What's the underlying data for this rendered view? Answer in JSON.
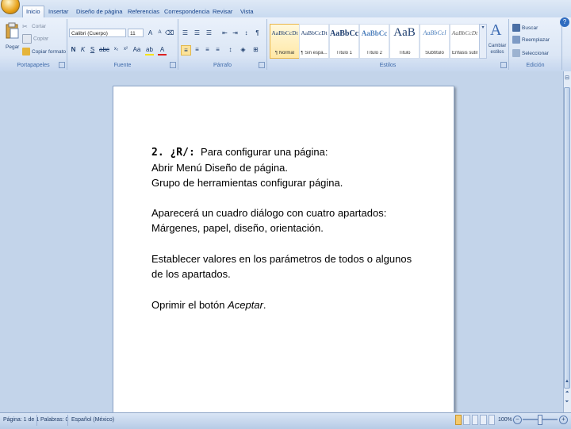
{
  "tabs": [
    "Inicio",
    "Insertar",
    "Diseño de página",
    "Referencias",
    "Correspondencia",
    "Revisar",
    "Vista"
  ],
  "clipboard": {
    "paste": "Pegar",
    "cut": "Cortar",
    "copy": "Copiar",
    "format_painter": "Copiar formato",
    "label": "Portapapeles"
  },
  "font": {
    "name": "Calibri (Cuerpo)",
    "size": "11",
    "label": "Fuente"
  },
  "paragraph": {
    "label": "Párrafo"
  },
  "styles": {
    "label": "Estilos",
    "items": [
      {
        "preview": "AaBbCcDt",
        "name": "¶ Normal"
      },
      {
        "preview": "AaBbCcDt",
        "name": "¶ Sin espa..."
      },
      {
        "preview": "AaBbCc",
        "name": "Título 1"
      },
      {
        "preview": "AaBbCc",
        "name": "Título 2"
      },
      {
        "preview": "AaB",
        "name": "Título"
      },
      {
        "preview": "AaBbCcl",
        "name": "Subtítulo"
      },
      {
        "preview": "AaBbCcDt",
        "name": "Énfasis sutil"
      }
    ],
    "change_styles": "Cambiar estilos"
  },
  "editing": {
    "find": "Buscar",
    "replace": "Reemplazar",
    "select": "Seleccionar",
    "label": "Edición"
  },
  "document": {
    "q_tag": "2. ¿R/:",
    "line1": "Para configurar una página:",
    "line2": "Abrir Menú Diseño de página.",
    "line3": "Grupo de herramientas configurar página.",
    "para2": "Aparecerá un cuadro diálogo con cuatro apartados: Márgenes, papel, diseño, orientación.",
    "para3": "Establecer valores en los parámetros de todos o algunos de los apartados.",
    "para4_prefix": "Oprimir el botón ",
    "para4_em": "Aceptar",
    "para4_suffix": "."
  },
  "status": {
    "page": "Página: 1 de 1",
    "words": "Palabras: 0",
    "language": "Español (México)",
    "zoom": "100%"
  }
}
